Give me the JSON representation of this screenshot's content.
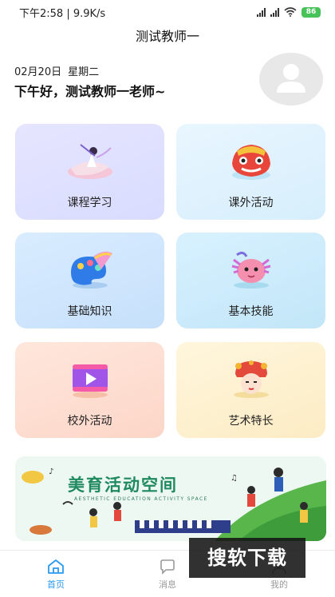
{
  "status_bar": {
    "time_speed": "下午2:58 | 9.9K/s",
    "battery": "86"
  },
  "app": {
    "title": "测试教师一"
  },
  "header": {
    "date": "02月20日",
    "weekday": "星期二",
    "greeting": "下午好，测试教师一老师~"
  },
  "cards": [
    {
      "label": "课程学习",
      "icon": "dancer-icon"
    },
    {
      "label": "课外活动",
      "icon": "lion-dance-icon"
    },
    {
      "label": "基础知识",
      "icon": "palette-icon"
    },
    {
      "label": "基本技能",
      "icon": "axolotl-icon"
    },
    {
      "label": "校外活动",
      "icon": "video-play-icon"
    },
    {
      "label": "艺术特长",
      "icon": "opera-mask-icon"
    }
  ],
  "banner": {
    "title": "美育活动空间",
    "subtitle": "AESTHETIC EDUCATION ACTIVITY SPACE"
  },
  "tabs": [
    {
      "label": "首页",
      "icon": "home-icon",
      "active": true
    },
    {
      "label": "消息",
      "icon": "message-icon",
      "active": false
    },
    {
      "label": "我的",
      "icon": "profile-icon",
      "active": false
    }
  ],
  "watermark": "搜软下载",
  "colors": {
    "accent": "#2a9af0",
    "banner_title": "#1f8a60",
    "battery": "#48c35a"
  }
}
